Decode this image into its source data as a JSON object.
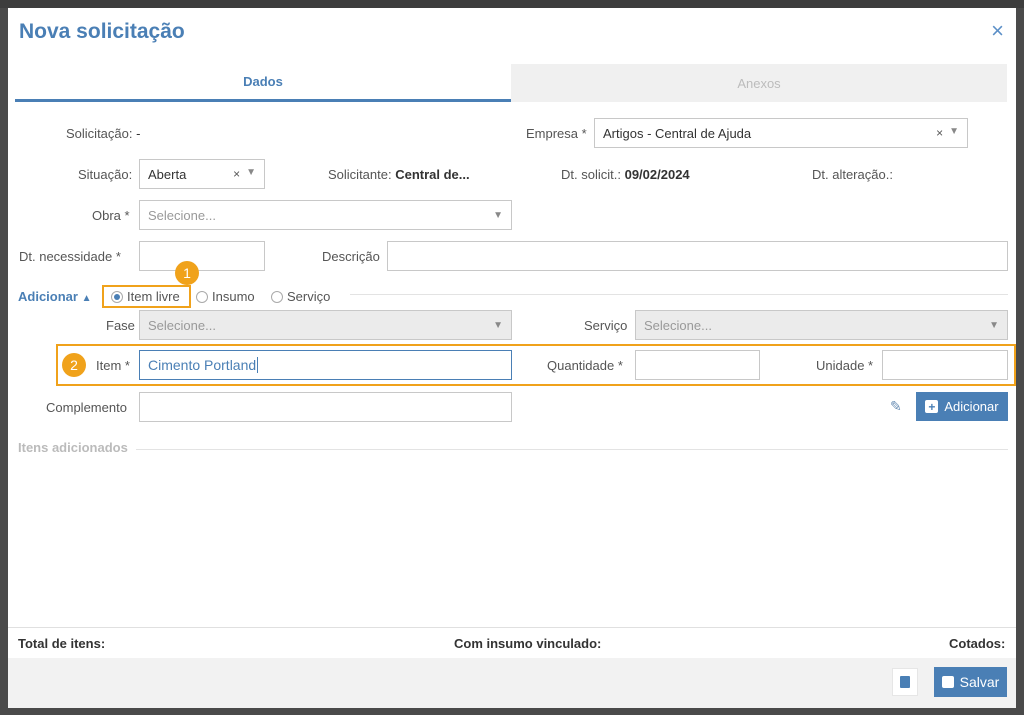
{
  "modal": {
    "title": "Nova solicitação",
    "close_icon": "×"
  },
  "tabs": [
    {
      "label": "Dados",
      "active": true
    },
    {
      "label": "Anexos",
      "active": false
    }
  ],
  "header": {
    "solicitacao_label": "Solicitação:",
    "solicitacao_value": "-",
    "empresa_label": "Empresa *",
    "empresa_value": "Artigos - Central de Ajuda",
    "situacao_label": "Situação:",
    "situacao_value": "Aberta",
    "solicitante_label": "Solicitante:",
    "solicitante_value": "Central de...",
    "dt_solicit_label": "Dt. solicit.:",
    "dt_solicit_value": "09/02/2024",
    "dt_alteracao_label": "Dt. alteração.:",
    "obra_label": "Obra *",
    "obra_placeholder": "Selecione...",
    "dt_necessidade_label": "Dt. necessidade *",
    "descricao_label": "Descrição"
  },
  "adicionar": {
    "toggle_label": "Adicionar",
    "radios": [
      {
        "label": "Item livre",
        "checked": true
      },
      {
        "label": "Insumo",
        "checked": false
      },
      {
        "label": "Serviço",
        "checked": false
      }
    ],
    "fase_label": "Fase",
    "fase_placeholder": "Selecione...",
    "servico_label": "Serviço",
    "servico_placeholder": "Selecione...",
    "item_label": "Item *",
    "item_value": "Cimento Portland",
    "quantidade_label": "Quantidade *",
    "unidade_label": "Unidade *",
    "complemento_label": "Complemento",
    "add_button_label": "Adicionar"
  },
  "callouts": [
    "1",
    "2"
  ],
  "itens_adicionados_label": "Itens adicionados",
  "summary": {
    "total_label": "Total de itens:",
    "insumo_label": "Com insumo vinculado:",
    "cotados_label": "Cotados:"
  },
  "footer": {
    "save_label": "Salvar"
  },
  "colors": {
    "accent": "#4a7fb5",
    "callout": "#f0a21b"
  }
}
